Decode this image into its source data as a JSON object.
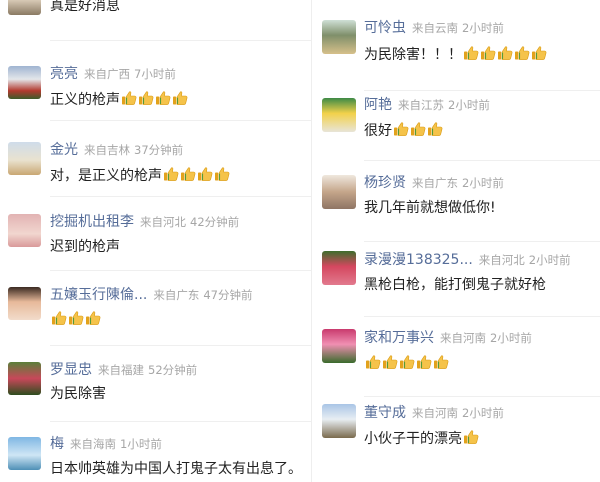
{
  "left_column": [
    {
      "username": "",
      "location": "",
      "time": "",
      "text": "真是好消息",
      "thumbs": 0,
      "avatar": "avatar-image"
    },
    {
      "username": "亮亮",
      "location": "来自广西",
      "time": "7小时前",
      "text": "正义的枪声",
      "thumbs": 4,
      "avatar": "avatar-image"
    },
    {
      "username": "金光",
      "location": "来自吉林",
      "time": "37分钟前",
      "text": "对，是正义的枪声",
      "thumbs": 4,
      "avatar": "avatar-image"
    },
    {
      "username": "挖掘机出租李",
      "location": "来自河北",
      "time": "42分钟前",
      "text": "迟到的枪声",
      "thumbs": 0,
      "avatar": "avatar-image"
    },
    {
      "username": "五孃玉行陳倫...",
      "location": "来自广东",
      "time": "47分钟前",
      "text": "",
      "thumbs": 3,
      "avatar": "avatar-image"
    },
    {
      "username": "罗显忠",
      "location": "来自福建",
      "time": "52分钟前",
      "text": "为民除害",
      "thumbs": 0,
      "avatar": "avatar-image"
    },
    {
      "username": "梅",
      "location": "来自海南",
      "time": "1小时前",
      "text": "日本帅英雄为中国人打鬼子太有出息了。",
      "thumbs": 0,
      "avatar": "avatar-image"
    }
  ],
  "right_column": [
    {
      "username": "可怜虫",
      "location": "来自云南",
      "time": "2小时前",
      "text": "为民除害！！！",
      "thumbs": 5,
      "avatar": "avatar-image"
    },
    {
      "username": "阿艳",
      "location": "来自江苏",
      "time": "2小时前",
      "text": "很好",
      "thumbs": 3,
      "avatar": "avatar-image"
    },
    {
      "username": "杨珍贤",
      "location": "来自广东",
      "time": "2小时前",
      "text": "我几年前就想做低你!",
      "thumbs": 0,
      "avatar": "avatar-image"
    },
    {
      "username": "录漫漫138325...",
      "location": "来自河北",
      "time": "2小时前",
      "text": "黑枪白枪，能打倒鬼子就好枪",
      "thumbs": 0,
      "avatar": "avatar-image"
    },
    {
      "username": "家和万事兴",
      "location": "来自河南",
      "time": "2小时前",
      "text": "",
      "thumbs": 5,
      "avatar": "avatar-image"
    },
    {
      "username": "董守成",
      "location": "来自河南",
      "time": "2小时前",
      "text": "小伙子干的漂亮",
      "thumbs": 1,
      "avatar": "avatar-image"
    }
  ]
}
